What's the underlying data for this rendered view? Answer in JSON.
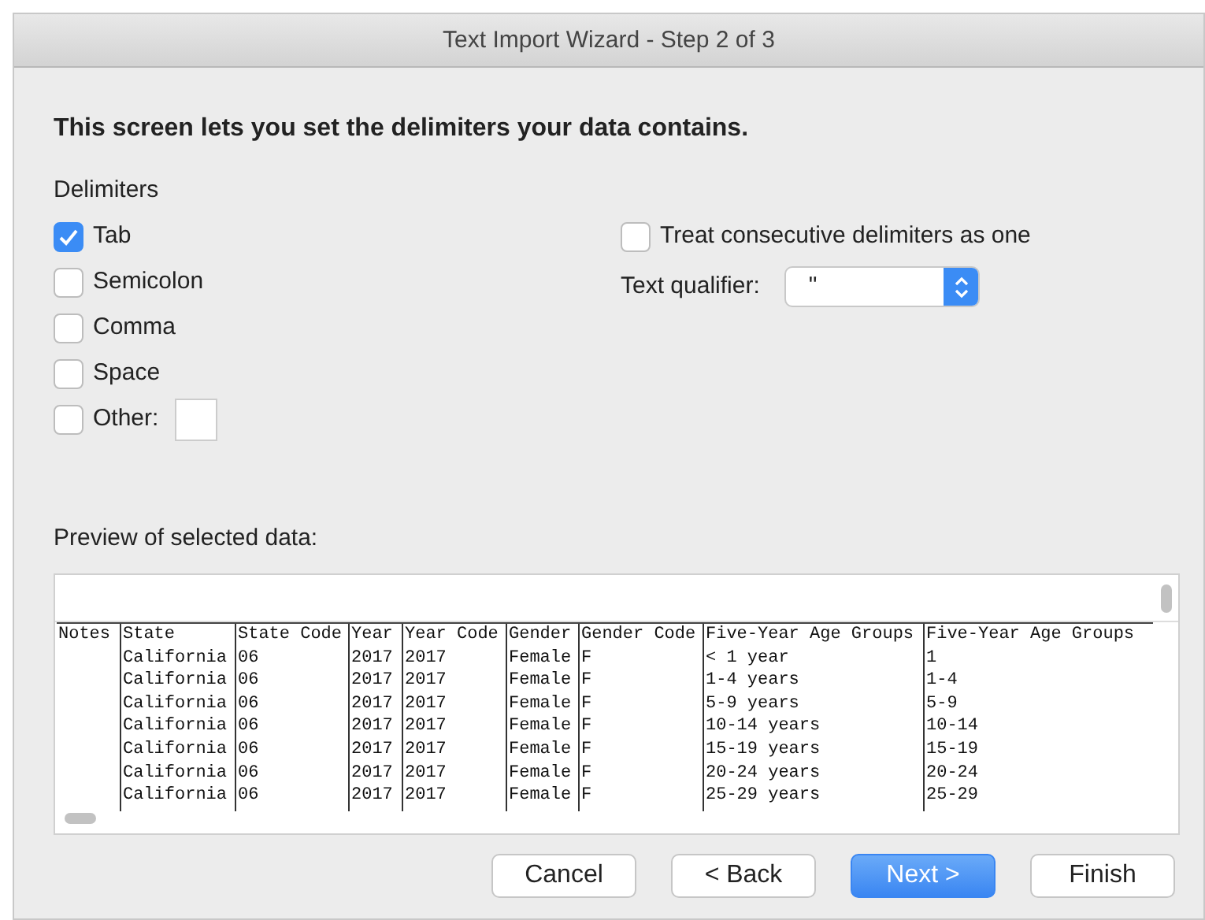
{
  "window": {
    "title": "Text Import Wizard - Step 2 of 3"
  },
  "heading": "This screen lets you set the delimiters your data contains.",
  "delimiters": {
    "label": "Delimiters",
    "items": [
      {
        "kind": "checkbox",
        "label": "Tab",
        "checked": true
      },
      {
        "kind": "checkbox",
        "label": "Semicolon",
        "checked": false
      },
      {
        "kind": "checkbox",
        "label": "Comma",
        "checked": false
      },
      {
        "kind": "checkbox",
        "label": "Space",
        "checked": false
      },
      {
        "kind": "checkbox-with-field",
        "label": "Other:",
        "checked": false
      }
    ]
  },
  "consecutive": {
    "label": "Treat consecutive delimiters as one",
    "checked": false
  },
  "text_qualifier": {
    "label": "Text qualifier:",
    "value": "\""
  },
  "preview": {
    "label": "Preview of selected data:",
    "columns": [
      "Notes",
      "State",
      "State Code",
      "Year",
      "Year Code",
      "Gender",
      "Gender Code",
      "Five-Year Age Groups",
      "Five-Year Age Groups"
    ],
    "rows": [
      [
        null,
        "California",
        "06",
        "2017",
        "2017",
        "Female",
        "F",
        "< 1 year",
        "1"
      ],
      [
        null,
        "California",
        "06",
        "2017",
        "2017",
        "Female",
        "F",
        "1-4 years",
        "1-4"
      ],
      [
        null,
        "California",
        "06",
        "2017",
        "2017",
        "Female",
        "F",
        "5-9 years",
        "5-9"
      ],
      [
        null,
        "California",
        "06",
        "2017",
        "2017",
        "Female",
        "F",
        "10-14 years",
        "10-14"
      ],
      [
        null,
        "California",
        "06",
        "2017",
        "2017",
        "Female",
        "F",
        "15-19 years",
        "15-19"
      ],
      [
        null,
        "California",
        "06",
        "2017",
        "2017",
        "Female",
        "F",
        "20-24 years",
        "20-24"
      ],
      [
        null,
        "California",
        "06",
        "2017",
        "2017",
        "Female",
        "F",
        "25-29 years",
        "25-29"
      ]
    ]
  },
  "buttons": [
    {
      "label": "Cancel",
      "default": false
    },
    {
      "label": "< Back",
      "default": false
    },
    {
      "label": "Next >",
      "default": true
    },
    {
      "label": "Finish",
      "default": false
    }
  ]
}
